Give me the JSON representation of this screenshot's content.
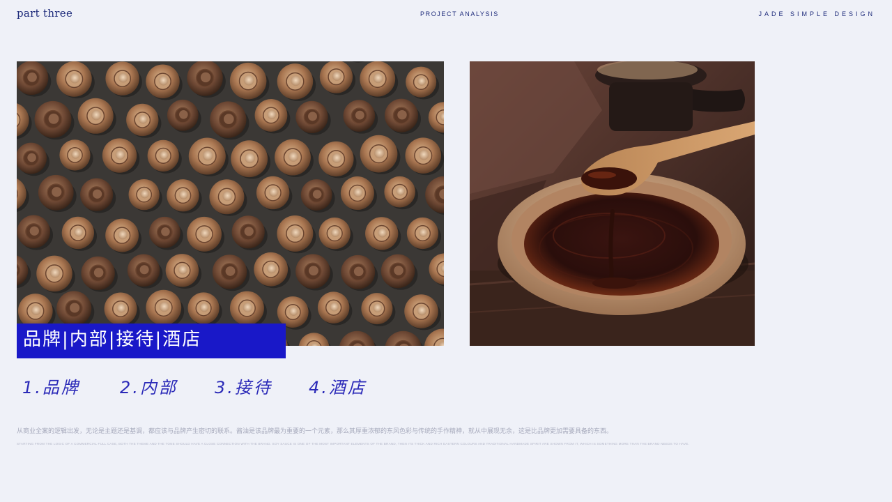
{
  "header": {
    "part_label": "part three",
    "section_title": "PROJECT ANALYSIS",
    "brand": "JADE SIMPLE DESIGN"
  },
  "images": {
    "left": "clay-wine-jars-photo",
    "right": "soy-sauce-spoon-photo"
  },
  "label_box": {
    "text": "品牌|内部|接待|酒店"
  },
  "items": [
    "1.品牌",
    "2.内部",
    "3.接待",
    "4.酒店"
  ],
  "description": {
    "chinese": "从商业全案的逻辑出发，无论是主题还是基调，都应该与品牌产生密切的联系。酱油是该品牌最为重要的一个元素，那么其厚重浓郁的东风色彩与传统的手作精神，就从中展现无余，这是比品牌更加需要具备的东西。",
    "english": "STARTING FROM THE LOGIC OF A COMMERCIAL FULL CASE, BOTH THE THEME AND THE TONE SHOULD HAVE A CLOSE CONNECTION WITH THE BRAND. SOY SAUCE IS ONE OF THE MOST IMPORTANT ELEMENTS OF THE BRAND, THEN ITS THICK AND RICH EASTERN COLOURS AND TRADITIONAL HANDMADE SPIRIT ARE SHOWN FROM IT, WHICH IS SOMETHING MORE THAN THE BRAND NEEDS TO HAVE."
  },
  "colors": {
    "background": "#eff1f8",
    "accent_blue": "#1918c8",
    "text_navy": "#1d2a7a"
  }
}
